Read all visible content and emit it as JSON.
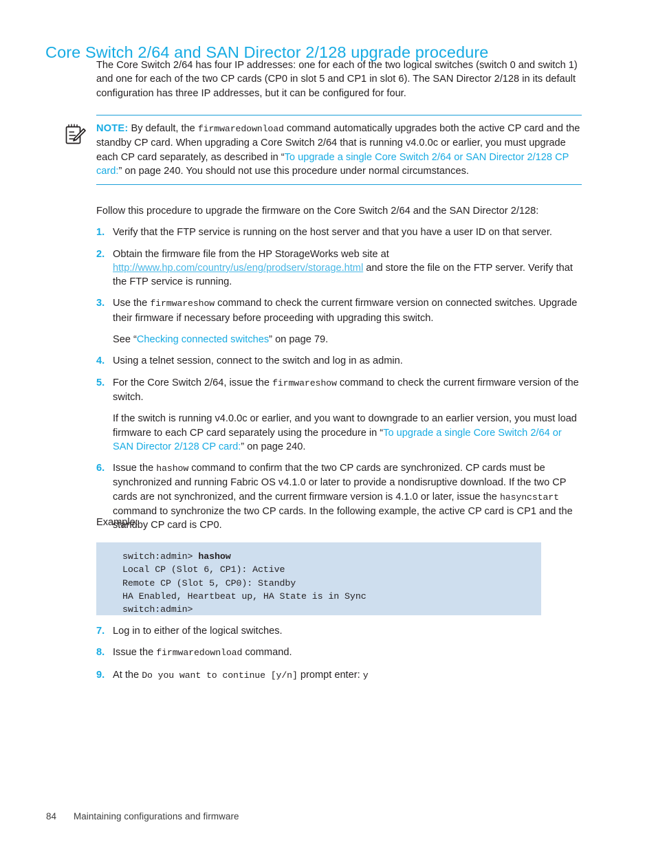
{
  "heading": "Core Switch 2/64 and SAN Director 2/128 upgrade procedure",
  "colors": {
    "accent_cyan": "#17abe3",
    "link_cyan": "#49b7e5",
    "code_background": "#cedeee",
    "body_text": "#231f20"
  },
  "intro": {
    "text": "The Core Switch 2/64 has four IP addresses: one for each of the two logical switches (switch 0 and switch 1) and one for each of the two CP cards (CP0 in slot 5 and CP1 in slot 6). The SAN Director 2/128 in its default configuration has three IP addresses, but it can be configured for four."
  },
  "note": {
    "icon": "note-pencil-icon",
    "label": "NOTE:",
    "part1": "By default, the ",
    "cmd1": "firmwaredownload",
    "part2": " command automatically upgrades both the active CP card and the standby CP card. When upgrading a Core Switch 2/64 that is running v4.0.0c or earlier, you must upgrade each CP card separately, as described in “",
    "xref": "To upgrade a single Core Switch 2/64 or SAN Director 2/128 CP card:",
    "part3": "” on page 240. You should not use this procedure under normal circumstances."
  },
  "lead_in": "Follow this procedure to upgrade the firmware on the Core Switch 2/64 and the SAN Director 2/128:",
  "steps": [
    {
      "num": "1.",
      "text": "Verify that the FTP service is running on the host server and that you have a user ID on that server."
    },
    {
      "num": "2.",
      "pre": "Obtain the firmware file from the HP StorageWorks web site at ",
      "url": "http://www.hp.com/country/us/eng/prodserv/storage.html",
      "post": " and store the file on the FTP server. Verify that the FTP service is running."
    },
    {
      "num": "3.",
      "pre": "Use the ",
      "cmd": "firmwareshow",
      "post": " command to check the current firmware version on connected switches. Upgrade their firmware if necessary before proceeding with upgrading this switch.",
      "sub_pre": "See “",
      "sub_xref": "Checking connected switches",
      "sub_post": "” on page 79."
    },
    {
      "num": "4.",
      "text": "Using a telnet session, connect to the switch and log in as admin."
    },
    {
      "num": "5.",
      "pre": "For the Core Switch 2/64, issue the ",
      "cmd": "firmwareshow",
      "post": " command to check the current firmware version of the switch.",
      "sub_pre": "If the switch is running v4.0.0c or earlier, and you want to downgrade to an earlier version, you must load firmware to each CP card separately using the procedure in “",
      "sub_xref": "To upgrade a single Core Switch 2/64 or SAN Director 2/128 CP card:",
      "sub_post": "” on page 240."
    },
    {
      "num": "6.",
      "pre": "Issue the ",
      "cmd": "hashow",
      "mid": " command to confirm that the two CP cards are synchronized. CP cards must be synchronized and running Fabric OS v4.1.0 or later to provide a nondisruptive download. If the two CP cards are not synchronized, and the current firmware version is 4.1.0 or later, issue the ",
      "cmd2": "hasyncstart",
      "post": " command to synchronize the two CP cards. In the following example, the active CP card is CP1 and the standby CP card is CP0."
    }
  ],
  "example_label": "Example:",
  "code_block": {
    "line1_prompt": "switch:admin> ",
    "line1_cmd": "hashow",
    "line2": "Local CP (Slot 6, CP1): Active",
    "line3": "Remote CP (Slot 5, CP0): Standby",
    "line4": "HA Enabled, Heartbeat up, HA State is in Sync",
    "line5": "switch:admin>"
  },
  "steps_tail": [
    {
      "num": "7.",
      "text": "Log in to either of the logical switches."
    },
    {
      "num": "8.",
      "pre": "Issue the ",
      "cmd": "firmwaredownload",
      "post": " command."
    },
    {
      "num": "9.",
      "pre": "At the ",
      "cmd": "Do you want to continue [y/n]",
      "post": " prompt enter: ",
      "cmd2": "y"
    }
  ],
  "footer": {
    "page_number": "84",
    "chapter_title": "Maintaining configurations and firmware"
  }
}
